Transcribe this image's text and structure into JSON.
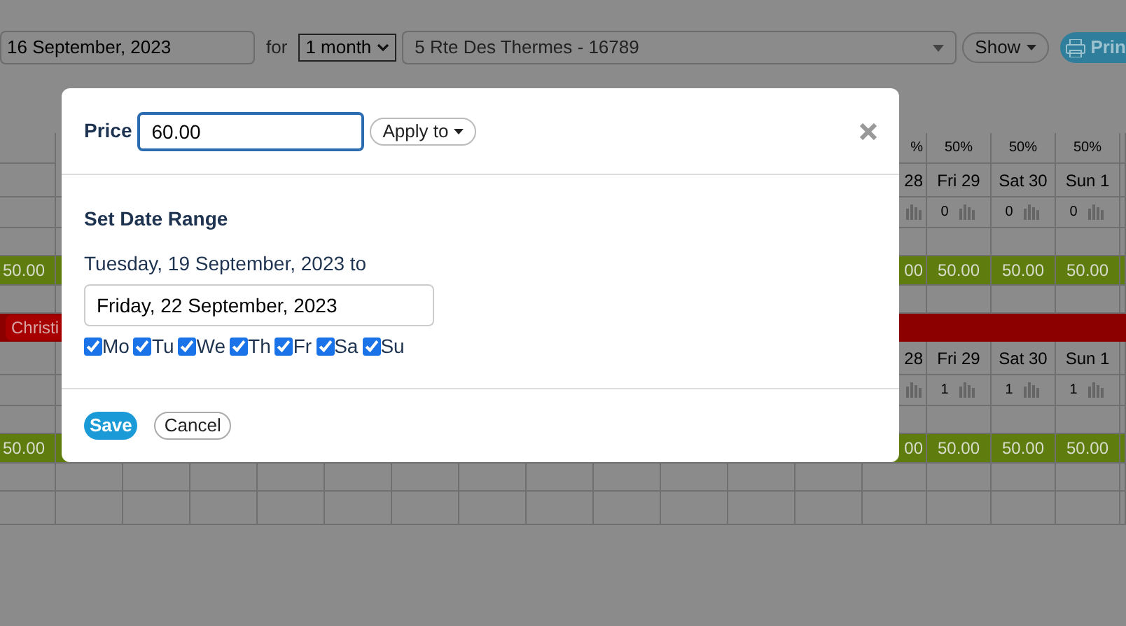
{
  "toolbar": {
    "start_date": "16 September, 2023",
    "for_label": "for",
    "period": "1 month",
    "property": "5 Rte Des Thermes - 16789",
    "show_button": "Show",
    "print_button": "Prin"
  },
  "calendar": {
    "sections": [
      {
        "left_price": "50.00",
        "columns": [
          {
            "percent": "%",
            "day": "28",
            "price": "00"
          },
          {
            "percent": "50%",
            "day": "Fri 29",
            "count": "0",
            "price": "50.00"
          },
          {
            "percent": "50%",
            "day": "Sat 30",
            "count": "0",
            "price": "50.00"
          },
          {
            "percent": "50%",
            "day": "Sun 1",
            "count": "0",
            "price": "50.00"
          }
        ]
      },
      {
        "left_price": "50.00",
        "columns": [
          {
            "day": "28",
            "price": "00"
          },
          {
            "day": "Fri 29",
            "count": "1",
            "price": "50.00"
          },
          {
            "day": "Sat 30",
            "count": "1",
            "price": "50.00"
          },
          {
            "day": "Sun 1",
            "count": "1",
            "price": "50.00"
          }
        ]
      }
    ],
    "booking_tag": "Christi"
  },
  "dialog": {
    "price_label": "Price",
    "price_value": "60.00",
    "apply_button": "Apply to",
    "title": "Set Date Range",
    "from_text": "Tuesday, 19 September, 2023 to",
    "to_date": "Friday, 22 September, 2023",
    "days": [
      {
        "label": "Mo",
        "checked": true
      },
      {
        "label": "Tu",
        "checked": true
      },
      {
        "label": "We",
        "checked": true
      },
      {
        "label": "Th",
        "checked": true
      },
      {
        "label": "Fr",
        "checked": true
      },
      {
        "label": "Sa",
        "checked": true
      },
      {
        "label": "Su",
        "checked": true
      }
    ],
    "save_button": "Save",
    "cancel_button": "Cancel"
  }
}
